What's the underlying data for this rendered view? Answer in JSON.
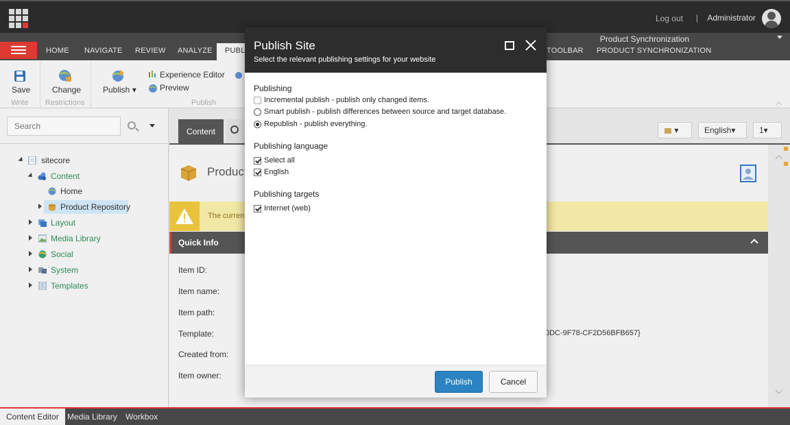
{
  "topbar": {
    "logout": "Log out",
    "separator": "|",
    "username": "Administrator"
  },
  "ribbon_tabs": {
    "items": [
      "HOME",
      "NAVIGATE",
      "REVIEW",
      "ANALYZE",
      "PUBLI",
      "TOOLBAR",
      "PRODUCT SYNCHRONIZATION"
    ],
    "active_index": 4,
    "context_title": "Product Synchronization"
  },
  "ribbon": {
    "save": "Save",
    "change": "Change",
    "publish": "Publish ▾",
    "experience_editor": "Experience Editor",
    "preview": "Preview",
    "group_write": "Write",
    "group_restrictions": "Restrictions",
    "group_publish": "Publish"
  },
  "left_panel": {
    "search_placeholder": "Search",
    "tree": {
      "root": "sitecore",
      "content": "Content",
      "home": "Home",
      "product_repository": "Product Repository",
      "layout": "Layout",
      "media_library": "Media Library",
      "social": "Social",
      "system": "System",
      "templates": "Templates"
    }
  },
  "content": {
    "tab_label": "Content",
    "btn_icon": "▾",
    "language": "English▾",
    "version": "1▾",
    "item_title": "Product",
    "warning_text": "The curren",
    "quick_info": "Quick Info",
    "labels": {
      "item_id": "Item ID:",
      "item_name": "Item name:",
      "item_path": "Item path:",
      "template": "Template:",
      "created_from": "Created from:",
      "item_owner": "Item owner:"
    },
    "template_id_fragment": "0DC-9F78-CF2D56BFB657}"
  },
  "dialog": {
    "title": "Publish Site",
    "subtitle": "Select the relevant publishing settings for your website",
    "section_publishing": "Publishing",
    "opt_incremental": "Incremental publish - publish only changed items.",
    "opt_smart": "Smart publish - publish differences between source and target database.",
    "opt_republish": "Republish - publish everything.",
    "section_language": "Publishing language",
    "lang_select_all": "Select all",
    "lang_english": "English",
    "section_targets": "Publishing targets",
    "target_internet": "Internet (web)",
    "publish_button": "Publish",
    "cancel_button": "Cancel"
  },
  "bottom_tabs": {
    "content_editor": "Content Editor",
    "media_library": "Media Library",
    "workbox": "Workbox"
  },
  "colors": {
    "accent_red": "#dc3a32",
    "primary_blue": "#2b83c1",
    "tree_green": "#2e8b57"
  }
}
